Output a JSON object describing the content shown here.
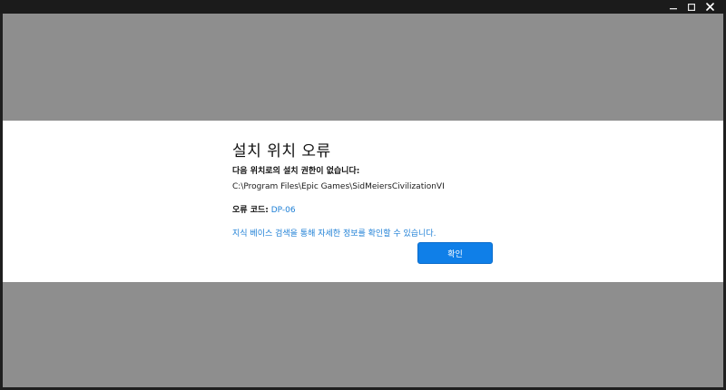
{
  "window": {
    "controls": [
      {
        "name": "minimize",
        "icon": "minimize-icon"
      },
      {
        "name": "maximize",
        "icon": "maximize-icon"
      },
      {
        "name": "close",
        "icon": "close-icon"
      }
    ]
  },
  "dialog": {
    "title": "설치 위치 오류",
    "message": "다음 위치로의 설치 권한이 없습니다:",
    "path": "C:\\Program Files\\Epic Games\\SidMeiersCivilizationVI",
    "error_label": "오류 코드:",
    "error_code": "DP-06",
    "kb_link": "지식 베이스 검색을 통해 자세한 정보를 확인할 수 있습니다.",
    "confirm_label": "확인"
  },
  "colors": {
    "accent": "#0f7fe8",
    "link": "#1d7fd6",
    "overlay": "#8e8e8e",
    "titlebar": "#1b1b1b"
  }
}
